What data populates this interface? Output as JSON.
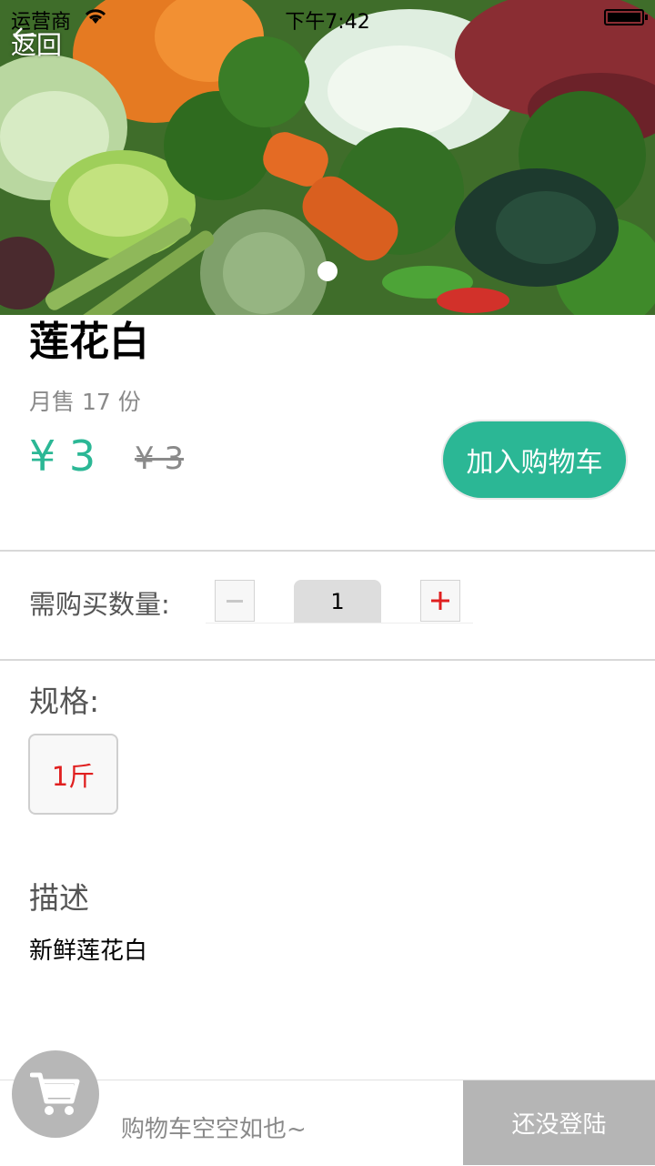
{
  "status_bar": {
    "carrier": "运营商",
    "time": "下午7:42"
  },
  "nav": {
    "back_label": "返回"
  },
  "product": {
    "name": "莲花白",
    "monthly_sales": "月售 17 份",
    "price": "¥ 3",
    "original_price": "¥ 3",
    "add_to_cart_label": "加入购物车"
  },
  "quantity": {
    "label": "需购买数量:",
    "value": "1"
  },
  "spec": {
    "label": "规格:",
    "options": [
      {
        "label": "1斤",
        "selected": true
      }
    ]
  },
  "description": {
    "label": "描述",
    "text": "新鲜莲花白"
  },
  "cart": {
    "empty_text": "购物车空空如也~",
    "login_label": "还没登陆"
  },
  "colors": {
    "accent": "#2bb795",
    "spec_text": "#e02020",
    "plus": "#e02020",
    "bar_gray": "#b5b5b5"
  },
  "carousel": {
    "page_count": 1,
    "current_page": 1
  }
}
